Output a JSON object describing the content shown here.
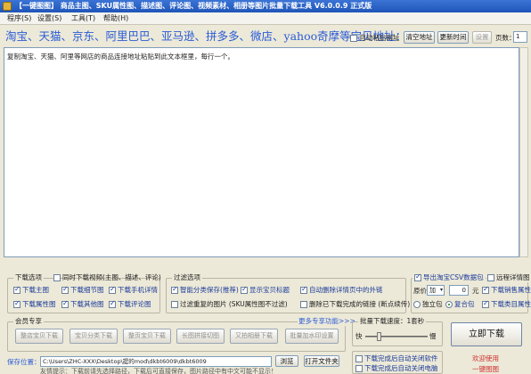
{
  "window": {
    "title": "【一键图图】 商品主图、SKU属性图、描述图、评论图、视频素材、相册等图片批量下载工具 V6.0.0.9 正式版"
  },
  "menu": {
    "items": [
      "程序(S)",
      "设置(S)",
      "工具(T)",
      "帮助(H)"
    ]
  },
  "urlbar": {
    "platforms": "淘宝、天猫、京东、阿里巴巴、亚马逊、拼多多、微店、yahoo奇摩等宝贝地址：",
    "auto_paste": "自动粘贴网址",
    "clear_btn": "清空地址",
    "timer_btn": "更新时间",
    "settings_btn": "设置",
    "page_label": "页数：",
    "page_value": "1"
  },
  "textarea": {
    "hint": "复制淘宝、天猫、阿里等网店的商品连接地址粘贴到此文本框里，每行一个。"
  },
  "download_options": {
    "title": "下载选项",
    "sync_video": "同时下载视频(主图、描述、评论)",
    "items": [
      {
        "label": "下载主图",
        "checked": true
      },
      {
        "label": "下载细节图",
        "checked": true
      },
      {
        "label": "下载手机详情",
        "checked": true
      },
      {
        "label": "下载属性图",
        "checked": true
      },
      {
        "label": "下载其他图",
        "checked": true
      },
      {
        "label": "下载评论图",
        "checked": true
      }
    ]
  },
  "filter_options": {
    "title": "过滤选项",
    "items": [
      {
        "label": "智能分类保存(推荐)",
        "checked": true
      },
      {
        "label": "显示宝贝标题",
        "checked": true
      },
      {
        "label": "自动删除详情页中的外链",
        "checked": true
      },
      {
        "label": "过滤重复的图片 (SKU属性图不过滤)",
        "checked": false
      },
      {
        "label": "删除已下载完成的链接 (断点续传)",
        "checked": false
      }
    ]
  },
  "csv": {
    "export_csv": "导出淘宝CSV数据包",
    "remote_detail": "远程详情图",
    "price_label": "原价",
    "price_op": "加",
    "price_value": "0",
    "price_unit": "元",
    "sales_attr": "下载销售属性",
    "radio_single": "独立包",
    "radio_merge": "复合包",
    "class_attr": "下载类目属性"
  },
  "member": {
    "title": "会员专享",
    "more": "更多专享功能>>>",
    "buttons": [
      "整店宝贝下载",
      "宝贝分类下载",
      "整页宝贝下载",
      "长图拼接切图",
      "又拍相册下载",
      "批量加水印设置"
    ]
  },
  "save": {
    "label": "保存位置：",
    "path": "C:\\Users\\ZHC-XXX\\Desktop\\提的mod\\dkbt6009\\dkbt6009",
    "browse": "浏览",
    "open": "打开文件夹",
    "tip": "友情提示：下载前请先选择路径，下载后可直接保存，图片路径中有中文可能不显示！"
  },
  "speed": {
    "title": "批量下载速度：1套秒",
    "slow": "快",
    "fast": "慢",
    "value_pct": 20
  },
  "finish": {
    "close_soft": "下载完成后自动关闭软件",
    "shutdown": "下载完成后自动关闭电脑"
  },
  "actions": {
    "download": "立即下载",
    "welcome": "欢迎使用",
    "brand": "一键图图"
  },
  "colors": {
    "accent": "#2a5bd7",
    "brand_red": "#d03030"
  }
}
